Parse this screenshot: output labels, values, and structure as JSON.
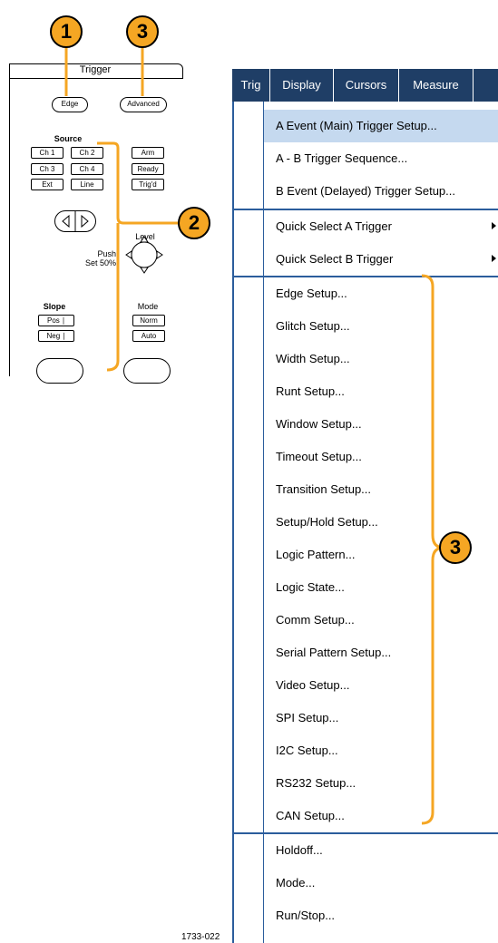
{
  "callouts": {
    "one": "1",
    "two": "2",
    "three": "3"
  },
  "panel": {
    "title": "Trigger",
    "edge": "Edge",
    "advanced": "Advanced",
    "source_label": "Source",
    "source_buttons": [
      "Ch 1",
      "Ch 2",
      "Ch 3",
      "Ch 4",
      "Ext",
      "Line"
    ],
    "status_buttons": [
      "Arm",
      "Ready",
      "Trig'd"
    ],
    "level_label": "Level",
    "push_label": "Push",
    "set50_label": "Set 50%",
    "slope_label": "Slope",
    "slope_pos": "Pos",
    "slope_neg": "Neg",
    "mode_label": "Mode",
    "mode_norm": "Norm",
    "mode_auto": "Auto"
  },
  "menu": {
    "tabs": [
      "Trig",
      "Display",
      "Cursors",
      "Measure"
    ],
    "items": [
      "A Event (Main) Trigger Setup...",
      "A - B Trigger Sequence...",
      "B Event (Delayed) Trigger Setup...",
      "Quick Select A Trigger",
      "Quick Select B Trigger",
      "Edge Setup...",
      "Glitch Setup...",
      "Width Setup...",
      "Runt Setup...",
      "Window Setup...",
      "Timeout Setup...",
      "Transition Setup...",
      "Setup/Hold Setup...",
      "Logic Pattern...",
      "Logic State...",
      "Comm Setup...",
      "Serial Pattern Setup...",
      "Video Setup...",
      "SPI Setup...",
      "I2C Setup...",
      "RS232 Setup...",
      "CAN Setup...",
      "Holdoff...",
      "Mode...",
      "Run/Stop..."
    ]
  },
  "figure_id": "1733-022",
  "colors": {
    "accent": "#f5a623",
    "menubar": "#1f3e66",
    "highlight": "#c5d9ef",
    "border": "#2b5d9c"
  }
}
